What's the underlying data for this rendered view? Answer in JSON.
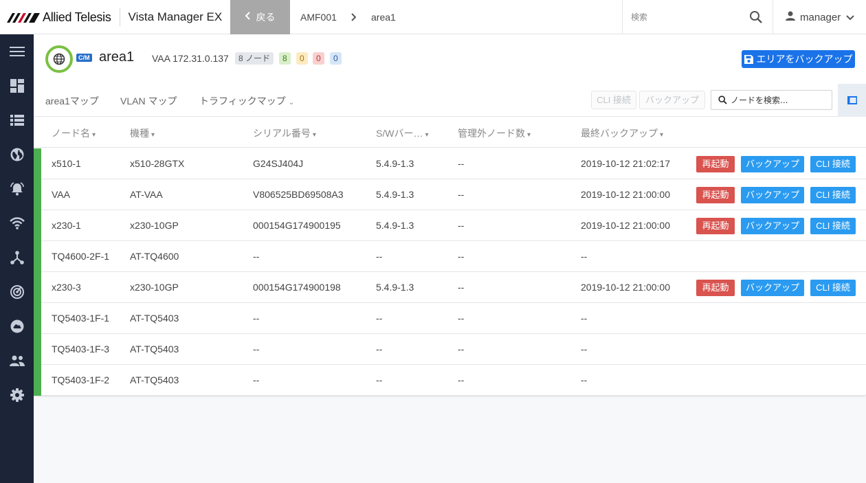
{
  "header": {
    "brand": "Allied Telesis",
    "app_name": "Vista Manager EX",
    "back_label": "戻る",
    "breadcrumbs": [
      "AMF001",
      "area1"
    ],
    "search_placeholder": "検索",
    "user": "manager"
  },
  "sidebar": {
    "items": [
      {
        "icon": "menu-icon"
      },
      {
        "icon": "dashboard-icon"
      },
      {
        "icon": "list-icon"
      },
      {
        "icon": "globe-icon"
      },
      {
        "icon": "alarm-bell-icon"
      },
      {
        "icon": "wifi-icon"
      },
      {
        "icon": "network-topology-icon"
      },
      {
        "icon": "radar-icon"
      },
      {
        "icon": "cloud-icon"
      },
      {
        "icon": "users-icon"
      },
      {
        "icon": "settings-gear-icon"
      }
    ]
  },
  "area": {
    "badge": "C/M",
    "title": "area1",
    "vaa": "VAA 172.31.0.137",
    "node_count": "8 ノード",
    "status_ok": "8",
    "status_warn": "0",
    "status_err": "0",
    "status_info": "0",
    "backup_area_label": "エリアをバックアップ"
  },
  "tabs": {
    "map": "area1マップ",
    "vlan": "VLAN マップ",
    "traffic": "トラフィックマップ",
    "cli_connect": "CLI 接続",
    "backup": "バックアップ",
    "node_search_placeholder": "ノードを検索..."
  },
  "table": {
    "columns": [
      "ノード名",
      "機種",
      "シリアル番号",
      "S/Wバー…",
      "管理外ノード数",
      "最終バックアップ"
    ],
    "action_labels": {
      "reboot": "再起動",
      "backup": "バックアップ",
      "cli": "CLI 接続"
    },
    "rows": [
      {
        "name": "x510-1",
        "model": "x510-28GTX",
        "serial": "G24SJ404J",
        "sw": "5.4.9-1.3",
        "unmanaged": "--",
        "last_backup": "2019-10-12 21:02:17",
        "actions": true
      },
      {
        "name": "VAA",
        "model": "AT-VAA",
        "serial": "V806525BD69508A3",
        "sw": "5.4.9-1.3",
        "unmanaged": "--",
        "last_backup": "2019-10-12 21:00:00",
        "actions": true
      },
      {
        "name": "x230-1",
        "model": "x230-10GP",
        "serial": "000154G174900195",
        "sw": "5.4.9-1.3",
        "unmanaged": "--",
        "last_backup": "2019-10-12 21:00:00",
        "actions": true
      },
      {
        "name": "TQ4600-2F-1",
        "model": "AT-TQ4600",
        "serial": "--",
        "sw": "--",
        "unmanaged": "--",
        "last_backup": "--",
        "actions": false
      },
      {
        "name": "x230-3",
        "model": "x230-10GP",
        "serial": "000154G174900198",
        "sw": "5.4.9-1.3",
        "unmanaged": "--",
        "last_backup": "2019-10-12 21:00:00",
        "actions": true
      },
      {
        "name": "TQ5403-1F-1",
        "model": "AT-TQ5403",
        "serial": "--",
        "sw": "--",
        "unmanaged": "--",
        "last_backup": "--",
        "actions": false
      },
      {
        "name": "TQ5403-1F-3",
        "model": "AT-TQ5403",
        "serial": "--",
        "sw": "--",
        "unmanaged": "--",
        "last_backup": "--",
        "actions": false
      },
      {
        "name": "TQ5403-1F-2",
        "model": "AT-TQ5403",
        "serial": "--",
        "sw": "--",
        "unmanaged": "--",
        "last_backup": "--",
        "actions": false
      }
    ]
  },
  "colors": {
    "sidebar_bg": "#1c2438",
    "primary": "#1a73e8",
    "action_blue": "#2a9bf0",
    "reboot_red": "#d9534f",
    "status_green": "#4caf50"
  }
}
